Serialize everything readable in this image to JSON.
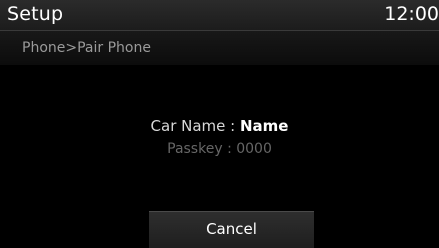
{
  "header": {
    "title": "Setup",
    "clock": "12:00"
  },
  "breadcrumb": {
    "text": "Phone>Pair Phone"
  },
  "pairing": {
    "car_name_label": "Car Name : ",
    "car_name_value": "Name",
    "passkey_label": "Passkey : ",
    "passkey_value": "0000"
  },
  "actions": {
    "cancel_label": "Cancel"
  }
}
